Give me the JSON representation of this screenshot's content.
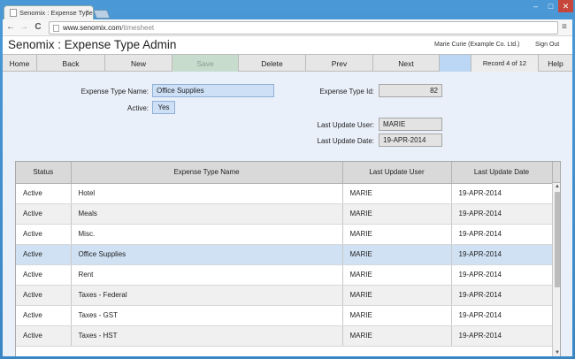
{
  "browser": {
    "tab_title": "Senomix : Expense Type A",
    "tab_close": "×",
    "url_host": "www.senomix.com",
    "url_path": "/timesheet",
    "back": "←",
    "forward": "→",
    "reload": "C",
    "menu": "≡",
    "win_min": "–",
    "win_max": "□",
    "win_close": "✕"
  },
  "header": {
    "title": "Senomix : Expense Type Admin",
    "user": "Marie Curie  (Example Co. Ltd.)",
    "sign_out": "Sign Out"
  },
  "buttons": {
    "home": "Home",
    "back": "Back",
    "new": "New",
    "save": "Save",
    "delete": "Delete",
    "prev": "Prev",
    "next": "Next",
    "record": "Record 4 of 12",
    "help": "Help"
  },
  "form": {
    "name_label": "Expense Type Name:",
    "name_value": "Office Supplies",
    "active_label": "Active:",
    "active_value": "Yes",
    "id_label": "Expense Type Id:",
    "id_value": "82",
    "user_label": "Last Update User:",
    "user_value": "MARIE",
    "date_label": "Last Update Date:",
    "date_value": "19-APR-2014"
  },
  "table": {
    "headers": [
      "Status",
      "Expense Type Name",
      "Last Update User",
      "Last Update Date"
    ],
    "rows": [
      [
        "Active",
        "Hotel",
        "MARIE",
        "19-APR-2014"
      ],
      [
        "Active",
        "Meals",
        "MARIE",
        "19-APR-2014"
      ],
      [
        "Active",
        "Misc.",
        "MARIE",
        "19-APR-2014"
      ],
      [
        "Active",
        "Office Supplies",
        "MARIE",
        "19-APR-2014"
      ],
      [
        "Active",
        "Rent",
        "MARIE",
        "19-APR-2014"
      ],
      [
        "Active",
        "Taxes - Federal",
        "MARIE",
        "19-APR-2014"
      ],
      [
        "Active",
        "Taxes - GST",
        "MARIE",
        "19-APR-2014"
      ],
      [
        "Active",
        "Taxes - HST",
        "MARIE",
        "19-APR-2014"
      ]
    ],
    "selected_index": 3,
    "scroll_up": "▲",
    "scroll_down": "▼"
  }
}
